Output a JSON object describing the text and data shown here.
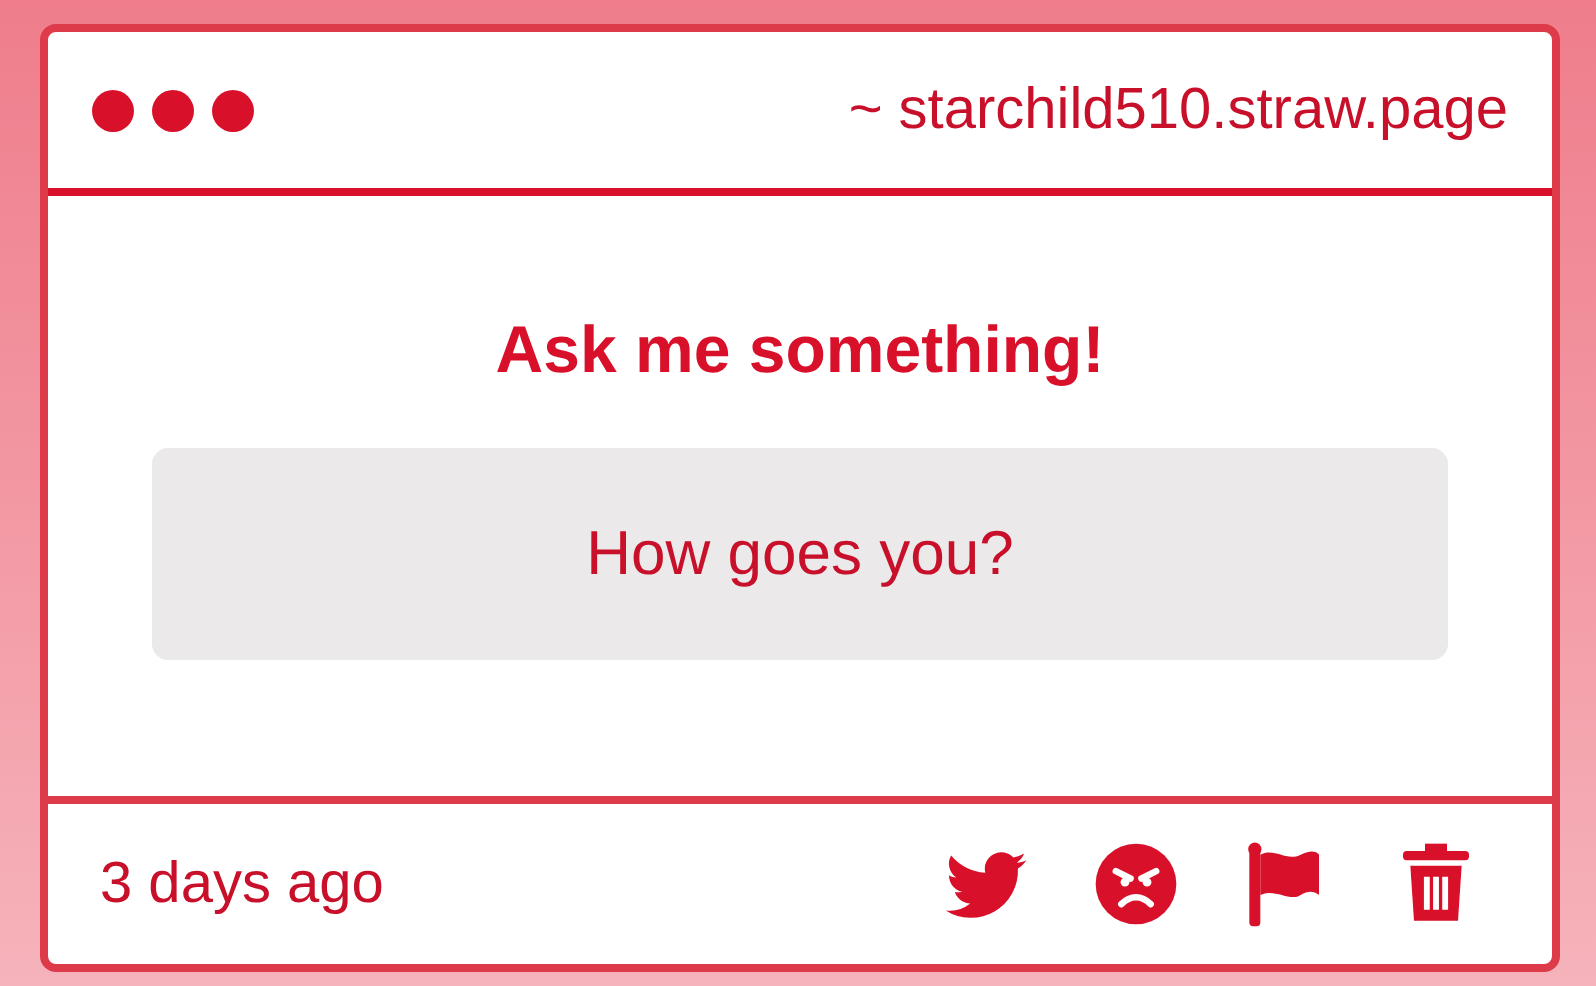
{
  "window": {
    "address": "~ starchild510.straw.page"
  },
  "heading": "Ask me something!",
  "question": "How goes you?",
  "footer": {
    "time": "3 days ago",
    "actions": [
      {
        "kind": "twitter"
      },
      {
        "kind": "angry"
      },
      {
        "kind": "flag"
      },
      {
        "kind": "trash"
      }
    ]
  }
}
